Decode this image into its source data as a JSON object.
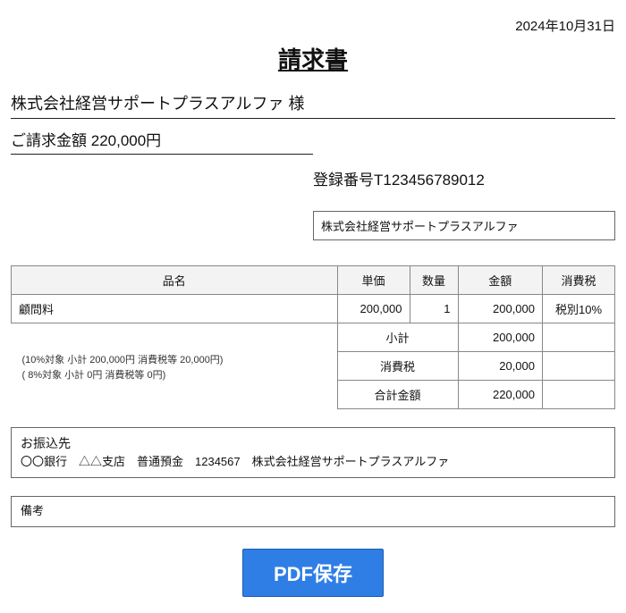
{
  "date": "2024年10月31日",
  "title": "請求書",
  "recipient": "株式会社経営サポートプラスアルファ 様",
  "billing_label": "ご請求金額",
  "billing_amount": "220,000円",
  "registration_label": "登録番号",
  "registration_number": "T123456789012",
  "issuer": "株式会社経営サポートプラスアルファ",
  "headers": {
    "name": "品名",
    "unit_price": "単価",
    "qty": "数量",
    "amount": "金額",
    "tax": "消費税"
  },
  "rows": [
    {
      "name": "顧問料",
      "unit_price": "200,000",
      "qty": "1",
      "amount": "200,000",
      "tax": "税別10%"
    }
  ],
  "breakdown": {
    "line1": "(10%対象 小計 200,000円 消費税等 20,000円)",
    "line2": "( 8%対象 小計 0円 消費税等 0円)"
  },
  "totals": {
    "subtotal_label": "小計",
    "subtotal": "200,000",
    "tax_label": "消費税",
    "tax": "20,000",
    "grand_label": "合計金額",
    "grand": "220,000"
  },
  "bank": {
    "title": "お振込先",
    "line": "〇〇銀行　△△支店　普通預金　1234567　株式会社経営サポートプラスアルファ"
  },
  "remarks_title": "備考",
  "pdf_button": "PDF保存"
}
